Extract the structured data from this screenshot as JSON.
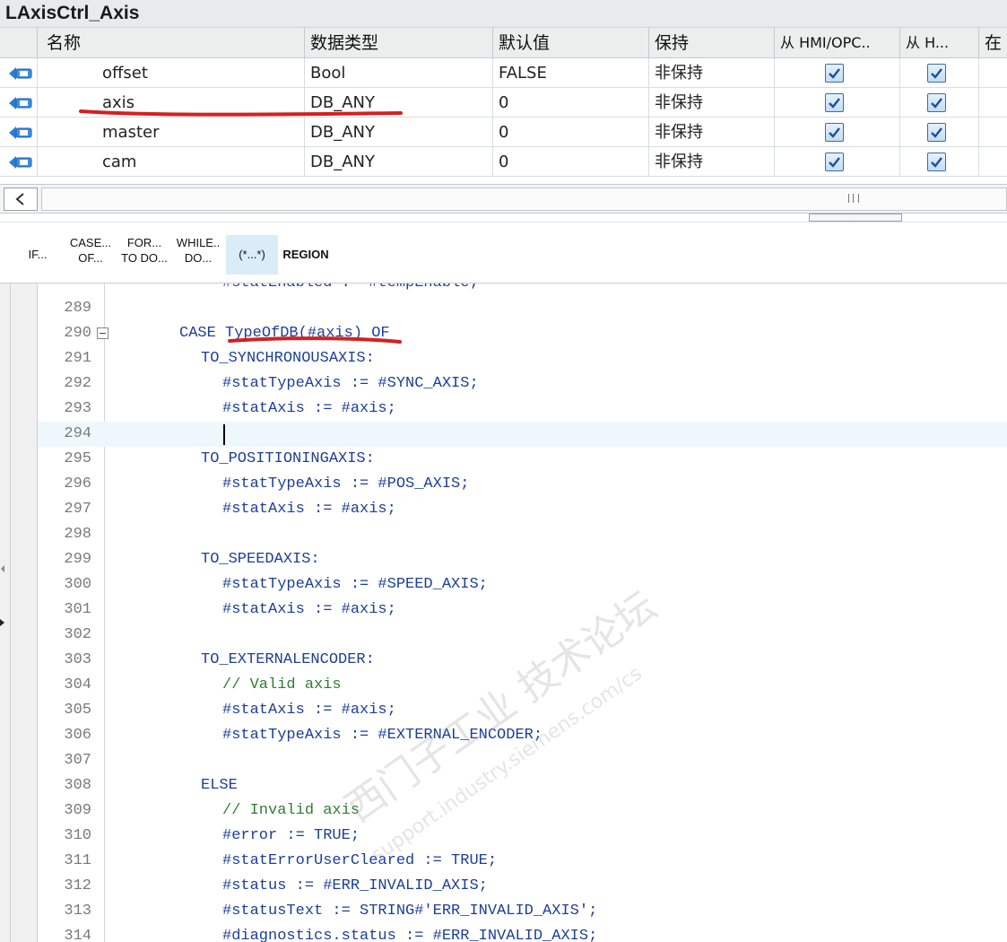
{
  "block_title": "LAxisCtrl_Axis",
  "table": {
    "headers": {
      "name": "名称",
      "datatype": "数据类型",
      "default": "默认值",
      "retain": "保持",
      "hmi_opc": "从 HMI/OPC..",
      "hmi": "从 H...",
      "in": "在"
    },
    "rows": [
      {
        "name": "offset",
        "datatype": "Bool",
        "default": "FALSE",
        "retain": "非保持"
      },
      {
        "name": "axis",
        "datatype": "DB_ANY",
        "default": "0",
        "retain": "非保持"
      },
      {
        "name": "master",
        "datatype": "DB_ANY",
        "default": "0",
        "retain": "非保持"
      },
      {
        "name": "cam",
        "datatype": "DB_ANY",
        "default": "0",
        "retain": "非保持"
      }
    ]
  },
  "toolbar": {
    "if": "IF...",
    "case_l1": "CASE...",
    "case_l2": "OF...",
    "for_l1": "FOR...",
    "for_l2": "TO DO...",
    "while_l1": "WHILE..",
    "while_l2": "DO...",
    "comment": "(*...*)",
    "region": "REGION"
  },
  "code": [
    {
      "n": "289",
      "text": "",
      "indent": 0,
      "style": "code"
    },
    {
      "n": "290",
      "text": "CASE TypeOfDB(#axis) OF",
      "indent": 0,
      "style": "kw"
    },
    {
      "n": "291",
      "text": "TO_SYNCHRONOUSAXIS:",
      "indent": 1,
      "style": "code"
    },
    {
      "n": "292",
      "text": "#statTypeAxis := #SYNC_AXIS;",
      "indent": 2,
      "style": "code"
    },
    {
      "n": "293",
      "text": "#statAxis := #axis;",
      "indent": 2,
      "style": "code"
    },
    {
      "n": "294",
      "text": "",
      "indent": 2,
      "style": "code"
    },
    {
      "n": "295",
      "text": "TO_POSITIONINGAXIS:",
      "indent": 1,
      "style": "code"
    },
    {
      "n": "296",
      "text": "#statTypeAxis := #POS_AXIS;",
      "indent": 2,
      "style": "code"
    },
    {
      "n": "297",
      "text": "#statAxis := #axis;",
      "indent": 2,
      "style": "code"
    },
    {
      "n": "298",
      "text": "",
      "indent": 0,
      "style": "code"
    },
    {
      "n": "299",
      "text": "TO_SPEEDAXIS:",
      "indent": 1,
      "style": "code"
    },
    {
      "n": "300",
      "text": "#statTypeAxis := #SPEED_AXIS;",
      "indent": 2,
      "style": "code"
    },
    {
      "n": "301",
      "text": "#statAxis := #axis;",
      "indent": 2,
      "style": "code"
    },
    {
      "n": "302",
      "text": "",
      "indent": 0,
      "style": "code"
    },
    {
      "n": "303",
      "text": "TO_EXTERNALENCODER:",
      "indent": 1,
      "style": "code"
    },
    {
      "n": "304",
      "text": "// Valid axis",
      "indent": 2,
      "style": "cmt"
    },
    {
      "n": "305",
      "text": "#statAxis := #axis;",
      "indent": 2,
      "style": "code"
    },
    {
      "n": "306",
      "text": "#statTypeAxis := #EXTERNAL_ENCODER;",
      "indent": 2,
      "style": "code"
    },
    {
      "n": "307",
      "text": "",
      "indent": 0,
      "style": "code"
    },
    {
      "n": "308",
      "text": "ELSE",
      "indent": 1,
      "style": "kw"
    },
    {
      "n": "309",
      "text": "// Invalid axis",
      "indent": 2,
      "style": "cmt"
    },
    {
      "n": "310",
      "text": "#error := TRUE;",
      "indent": 2,
      "style": "code"
    },
    {
      "n": "311",
      "text": "#statErrorUserCleared := TRUE;",
      "indent": 2,
      "style": "code"
    },
    {
      "n": "312",
      "text": "#status := #ERR_INVALID_AXIS;",
      "indent": 2,
      "style": "code"
    },
    {
      "n": "313",
      "text": "#statusText := STRING#'ERR_INVALID_AXIS';",
      "indent": 2,
      "style": "code"
    },
    {
      "n": "314",
      "text": "#diagnostics.status := #ERR_INVALID_AXIS;",
      "indent": 2,
      "style": "code"
    }
  ],
  "watermark": {
    "line1": "西门子工业 技术论坛",
    "line2": "support.industry.siemens.com/cs"
  },
  "colors": {
    "annotation_red": "#d42020",
    "keyword_blue": "#1f3d9e",
    "comment_green": "#2f7d32",
    "current_line": "#eef8fc"
  }
}
